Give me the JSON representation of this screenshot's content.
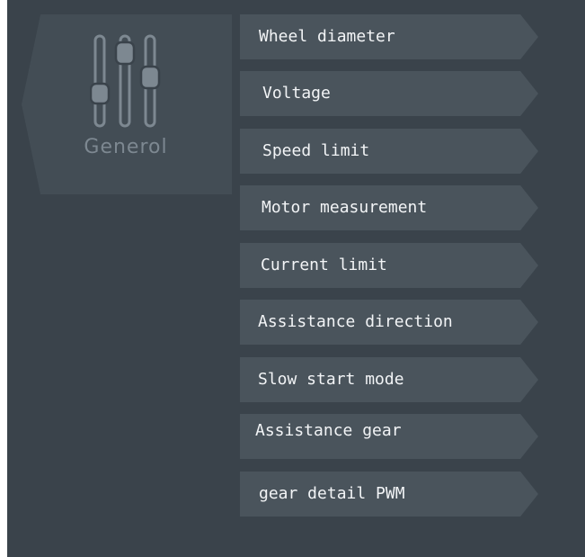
{
  "category": {
    "label": "Generol",
    "icon": "sliders-icon"
  },
  "menu": {
    "items": [
      {
        "label": "Wheel diameter"
      },
      {
        "label": "Voltage"
      },
      {
        "label": "Speed limit"
      },
      {
        "label": "Motor measurement"
      },
      {
        "label": "Current limit"
      },
      {
        "label": "Assistance direction"
      },
      {
        "label": "Slow start mode"
      },
      {
        "label": "Assistance gear"
      },
      {
        "label": "gear detail PWM"
      }
    ]
  },
  "colors": {
    "background": "#3a434b",
    "tab_background": "#434d55",
    "item_background": "#4a545c",
    "item_text": "#f2f4f6",
    "category_text": "#7d8891"
  }
}
